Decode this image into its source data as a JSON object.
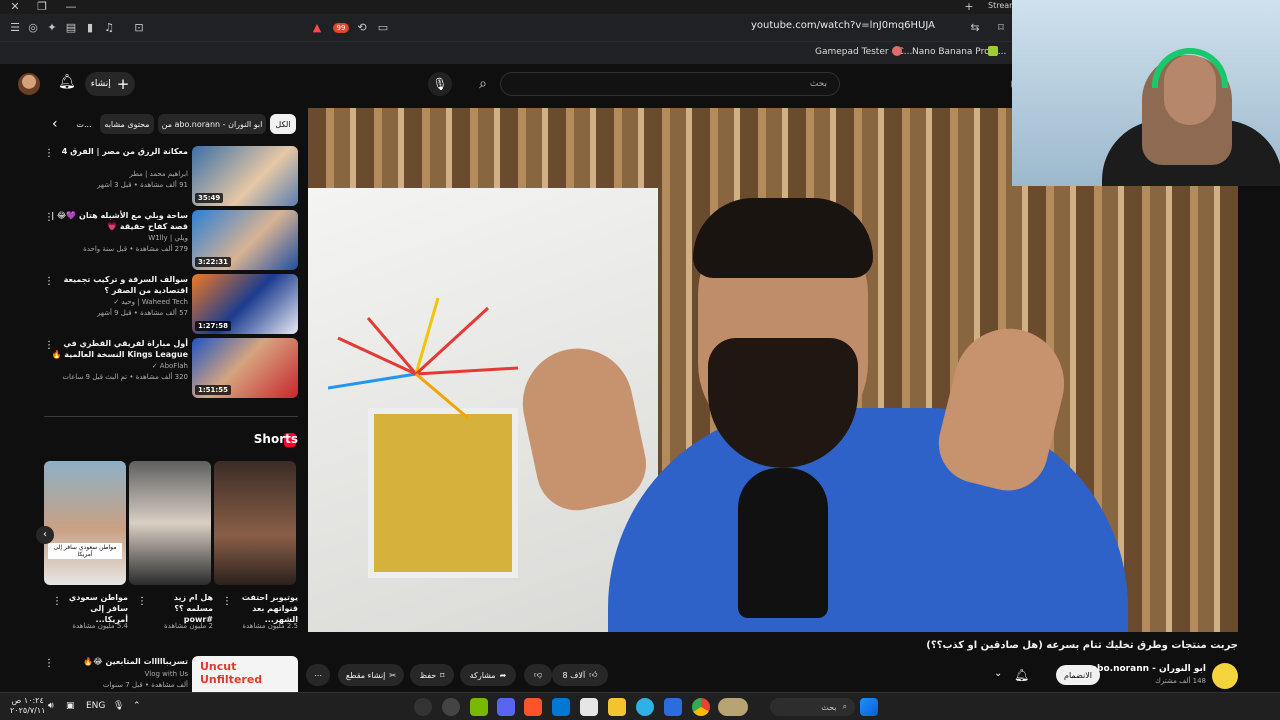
{
  "browser": {
    "url": "youtube.com/watch?v=lnJ0mq6HUJA",
    "title_fragment": "Stream",
    "bookmarks": [
      "Gamepad Tester - C...",
      "Nano Banana Pro o..."
    ],
    "extension_badge": "99"
  },
  "header": {
    "create_label": "إنشاء",
    "search_placeholder": "بحث"
  },
  "chips": [
    "الكل",
    "من abo.norann - ابو النوران",
    "محتوى مشابه",
    "ت..."
  ],
  "recommended": [
    {
      "title": "معكانة الرزق من مصر | الفرق 4",
      "channel": "ابراهيم محمد | مطر",
      "meta": "91 ألف مشاهدة • قبل 3 أشهر",
      "duration": "35:49",
      "color": "#3b6fa8"
    },
    {
      "title": "ساحة وبلي مع الأشبله هتان 💜😂 | قصة كفاح حقيقة 💗",
      "channel": "ويلي | W1lly",
      "meta": "279 ألف مشاهدة • قبل سنة واحدة",
      "duration": "3:22:31",
      "color": "#2a7fd6"
    },
    {
      "title": "سوالف السرقة و تركيب تجميعة اقتصادية من الصفر ؟",
      "channel": "Waheed Tech | وحيد ✓",
      "meta": "57 ألف مشاهدة • قبل 9 أشهر",
      "duration": "1:27:58",
      "color": "#f07a24"
    },
    {
      "title": "أول مباراة لفريقي القطري في Kings League النسخة العالمية 🔥 | مباشر",
      "channel": "AboFlah ✓",
      "meta": "320 ألف مشاهدة • تم البث قبل 9 ساعات",
      "duration": "1:51:55",
      "color": "#1f55c4"
    }
  ],
  "shorts": {
    "heading": "Shorts",
    "items": [
      {
        "title": "يوتيوبر احتفت قنواتهم بعد الشهر...",
        "views": "2.5 مليون مشاهدة",
        "color": "#6b4a3a"
      },
      {
        "title": "هل ام زيد مسلمه ؟؟ #powr",
        "views": "2 مليون مشاهدة",
        "color": "#4a4a4a"
      },
      {
        "title": "مواطن سعودي سافر إلى أمريكا...",
        "views": "5.4 مليون مشاهدة",
        "color": "#8aa0b0"
      }
    ],
    "caption": "مواطن سعودي سافر إلى أمريكا"
  },
  "bottom_rec": {
    "title": "تسريبااااات المتابعين 😂🔥",
    "channel": "Vlog with Us",
    "meta": "ألف مشاهدة • قبل 7 سنوات",
    "thumb_text": "Uncut Unfiltered"
  },
  "video": {
    "title": "جربت منتجات وطرق تخليك تنام بسرعه (هل صادقين او كذب؟؟)",
    "channel_name": "ابو النوران - abo.norann",
    "subscribers": "148 ألف مشترك",
    "join_label": "الانضمام",
    "likes": "8 آلاف",
    "share_label": "مشاركة",
    "save_label": "حفظ",
    "clip_label": "إنشاء مقطع"
  },
  "taskbar": {
    "time": "١٠:٢٤ ص",
    "date": "٢٠٢٥/٧/١١",
    "lang": "ENG",
    "search_label": "بحث"
  },
  "colors": {
    "background": "#0f0f0f",
    "accent": "#ff0033",
    "chip": "#272727"
  }
}
